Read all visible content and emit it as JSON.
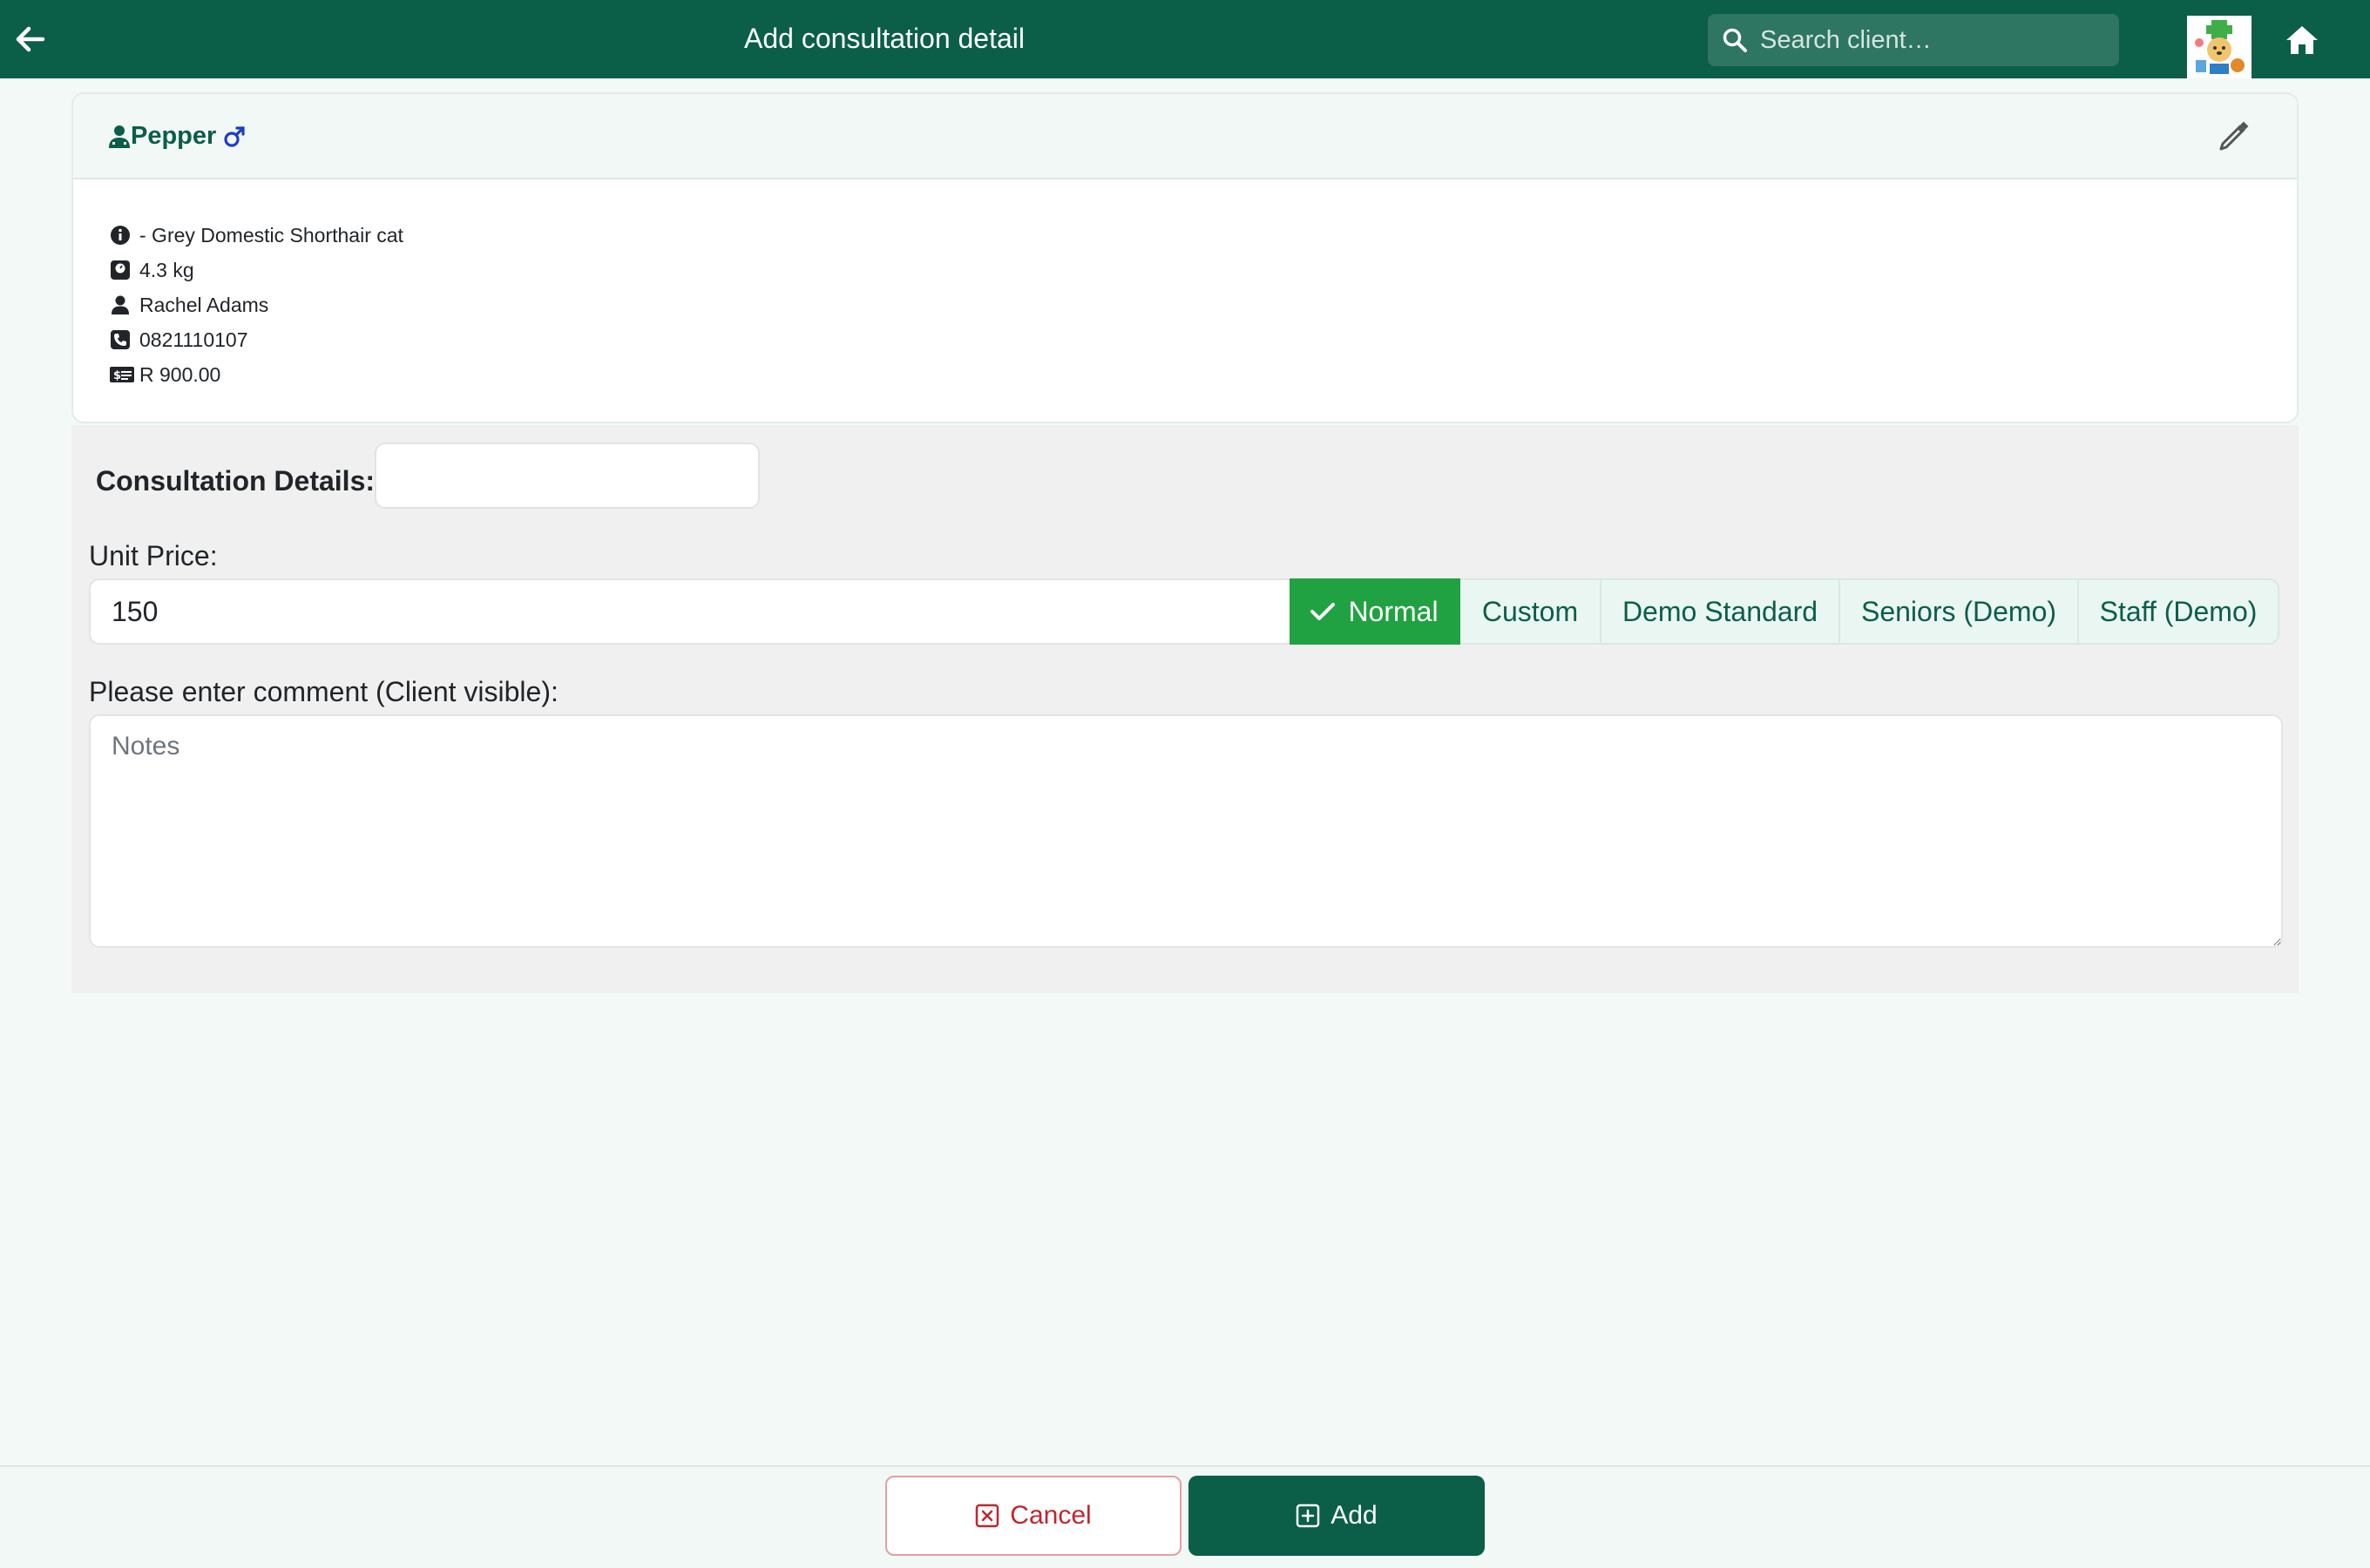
{
  "header": {
    "title": "Add consultation detail",
    "search_placeholder": "Search client…",
    "colors": {
      "bar": "#0b5e48",
      "search_bg": "#2e7562"
    }
  },
  "patient": {
    "name": "Pepper",
    "sex_icon": "male-symbol-icon",
    "details": {
      "breed": "- Grey Domestic Shorthair cat",
      "weight": "4.3 kg",
      "owner": "Rachel Adams",
      "phone": "0821110107",
      "balance": "R 900.00"
    }
  },
  "form": {
    "consultation_label": "Consultation Details:",
    "consultation_value": "",
    "unit_price_label": "Unit Price:",
    "unit_price_value": "150",
    "price_options": [
      {
        "label": "Normal",
        "active": true
      },
      {
        "label": "Custom",
        "active": false
      },
      {
        "label": "Demo Standard",
        "active": false
      },
      {
        "label": "Seniors (Demo)",
        "active": false
      },
      {
        "label": "Staff (Demo)",
        "active": false
      }
    ],
    "comment_label": "Please enter comment (Client visible):",
    "comment_placeholder": "Notes",
    "colors": {
      "active_option": "#21a242",
      "option_text": "#0b5e48"
    }
  },
  "footer": {
    "cancel_label": "Cancel",
    "add_label": "Add",
    "colors": {
      "cancel": "#c0262d",
      "add": "#0b5e48"
    }
  }
}
